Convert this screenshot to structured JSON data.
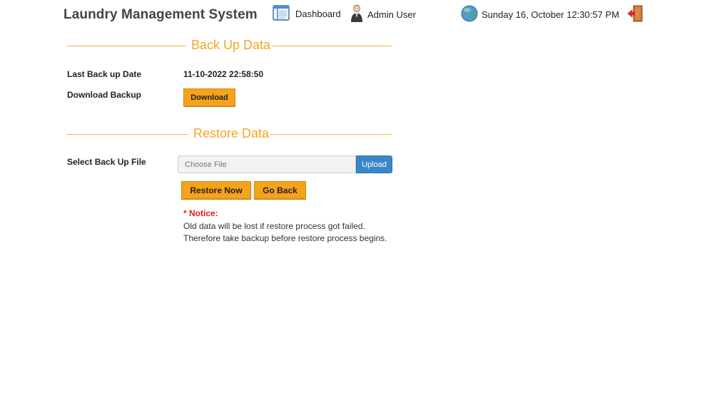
{
  "header": {
    "app_title": "Laundry Management System",
    "dashboard_label": "Dashboard",
    "user_label": "Admin User",
    "datetime": "Sunday 16, October 12:30:57 PM"
  },
  "backup": {
    "section_title": "Back Up Data",
    "last_backup_label": "Last Back up Date",
    "last_backup_value": "11-10-2022 22:58:50",
    "download_label": "Download Backup",
    "download_button": "Download"
  },
  "restore": {
    "section_title": "Restore Data",
    "select_file_label": "Select Back Up File",
    "file_placeholder": "Choose File",
    "upload_button": "Upload",
    "restore_button": "Restore Now",
    "go_back_button": "Go Back",
    "notice_title": "* Notice:",
    "notice_line1": "Old data will be lost if restore process got failed.",
    "notice_line2": "Therefore take backup before restore process begins."
  },
  "colors": {
    "accent": "#f5a623",
    "button": "#f7a21b",
    "upload": "#3a86c8",
    "notice": "#e01b1b"
  },
  "icons": {
    "dashboard": "dashboard-icon",
    "user": "user-icon",
    "globe": "globe-icon",
    "logout": "logout-icon"
  }
}
